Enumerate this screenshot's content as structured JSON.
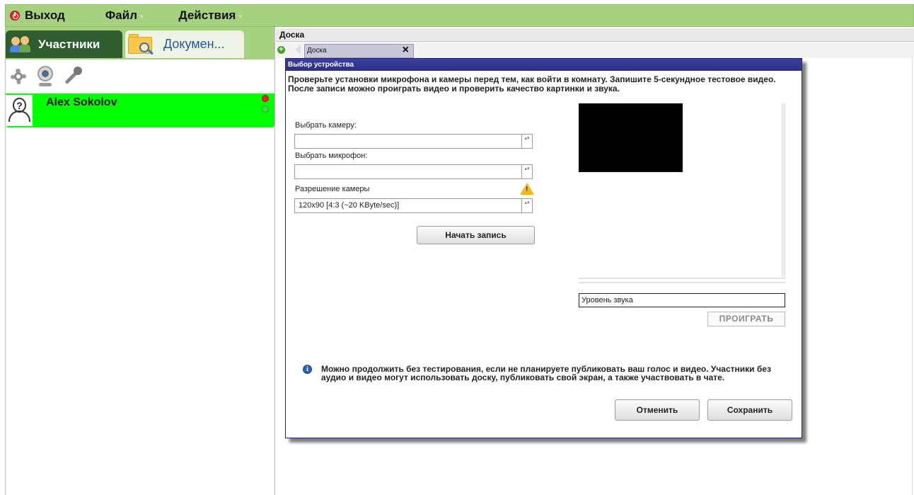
{
  "menubar": {
    "exit_label": "Выход",
    "file_label": "Файл",
    "actions_label": "Действия",
    "arrow": "▾"
  },
  "left_panel": {
    "tabs": [
      {
        "label": "Участники",
        "icon": "people-icon",
        "active": true
      },
      {
        "label": "Докумен...",
        "icon": "folder-search-icon",
        "active": false
      }
    ],
    "tools": [
      "gear-icon",
      "webcam-icon",
      "microphone-icon"
    ],
    "users": [
      {
        "name": "Alex Sokolov",
        "avatar": "?"
      }
    ]
  },
  "right": {
    "header": "Доска",
    "tab_label": "Доска",
    "tab_close": "×",
    "add": "+"
  },
  "modal": {
    "title": "Выбор устройства",
    "description": "Проверьте установки микрофона и камеры перед тем, как войти в комнату. Запишите 5-секундное тестовое видео. После записи можно проиграть видео и проверить качество картинки и звука.",
    "camera_label": "Выбрать камеру:",
    "camera_value": "",
    "mic_label": "Выбрать микрофон:",
    "mic_value": "",
    "resolution_label": "Разрешение камеры",
    "resolution_value": "120x90 [4:3 (~20 KByte/sec)]",
    "stepper": "▴▾",
    "record_button": "Начать запись",
    "sound_level": "Уровень звука",
    "play_button": "ПРОИГРАТЬ",
    "info_icon": "i",
    "info_text": "Можно продолжить без тестирования, если не планируете публиковать ваш голос и видео. Участники без аудио и видео могут использовать доску, публиковать свой экран, а также участвовать в чате.",
    "cancel_button": "Отменить",
    "save_button": "Сохранить"
  }
}
